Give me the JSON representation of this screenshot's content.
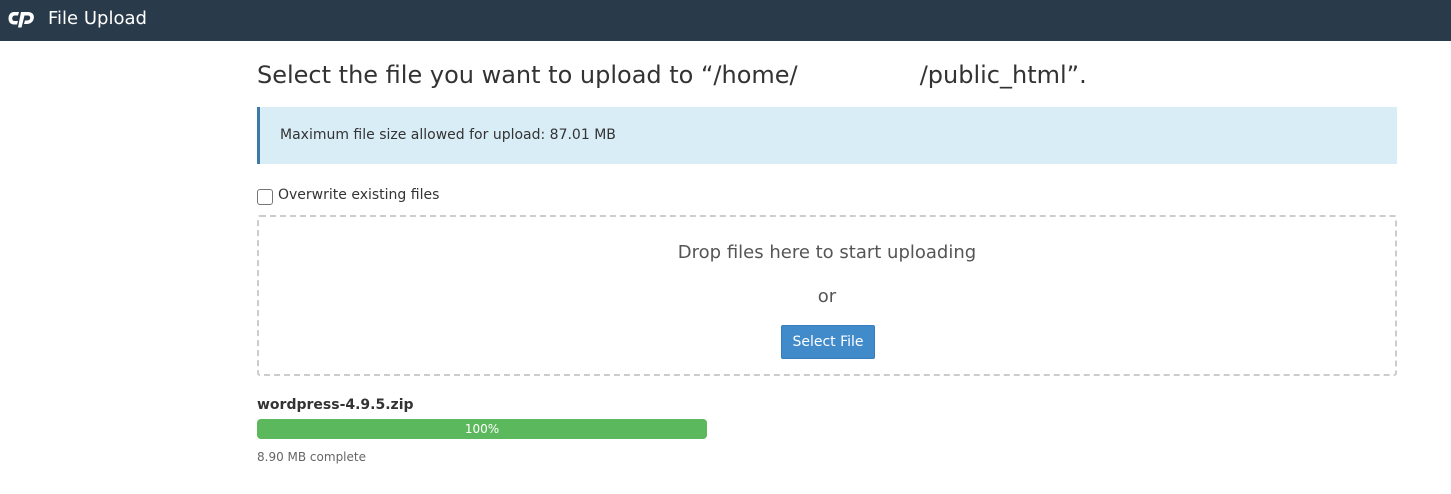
{
  "header": {
    "logo_icon": "cpanel-logo-icon",
    "title": "File Upload",
    "background_color": "#293a4a"
  },
  "main": {
    "heading": "Select the file you want to upload to “/home/                /public_html”.",
    "info": "Maximum file size allowed for upload: 87.01 MB",
    "overwrite": {
      "label": "Overwrite existing files",
      "checked": false
    },
    "dropzone": {
      "text": "Drop files here to start uploading",
      "or": "or",
      "button": "Select File"
    },
    "upload": {
      "file_name": "wordpress-4.9.5.zip",
      "progress_percent": 100,
      "progress_label": "100%",
      "status": "8.90 MB complete",
      "progress_color": "#5cb85c"
    }
  }
}
